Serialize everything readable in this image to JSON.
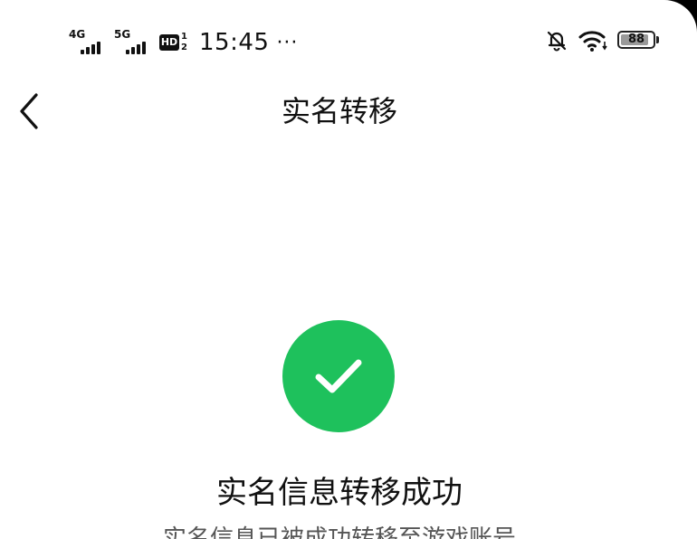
{
  "status_bar": {
    "network_1": "4G",
    "network_2": "5G",
    "hd_label": "HD",
    "hd_sup": "1",
    "hd_sub": "2",
    "time": "15:45",
    "more": "···",
    "battery_level": "88",
    "icons": [
      "signal-icon",
      "hd-icon",
      "bell-off-icon",
      "wifi-icon",
      "battery-icon"
    ]
  },
  "nav": {
    "title": "实名转移",
    "back_icon": "chevron-left-icon"
  },
  "result": {
    "icon": "check-circle-icon",
    "title": "实名信息转移成功",
    "description": "实名信息已被成功转移至游戏账号"
  },
  "colors": {
    "success": "#1ec15c",
    "text_primary": "#111111",
    "background": "#ffffff"
  }
}
